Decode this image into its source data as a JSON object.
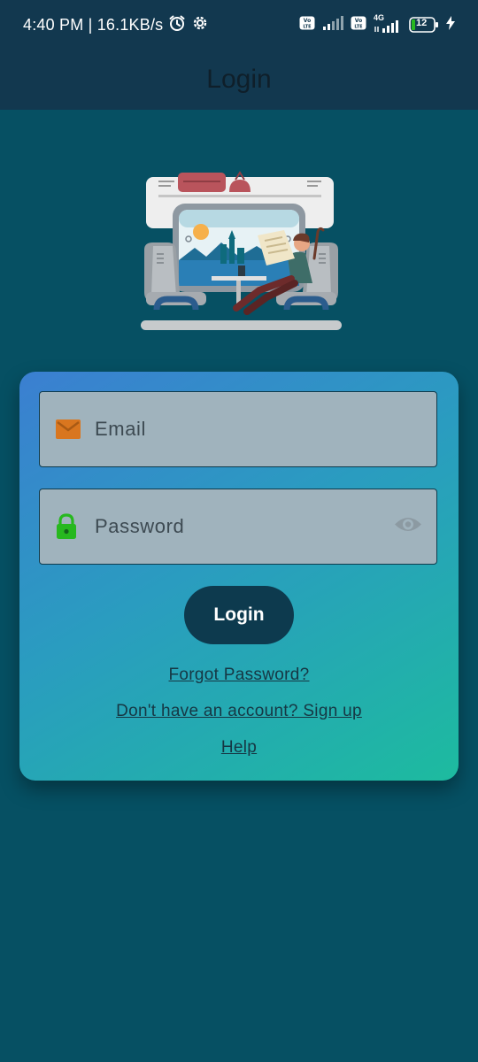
{
  "status_bar": {
    "time_speed": "4:40 PM | 16.1KB/s",
    "alarm_icon": "alarm-clock-icon",
    "settings_icon": "gear-icon",
    "volte_badge": "Vo LTE",
    "network_type": "4G",
    "battery_level": "12",
    "charging_icon": "lightning-icon"
  },
  "app_bar": {
    "title": "Login"
  },
  "hero": {
    "illustration": "train-passenger-reading-newspaper-illustration"
  },
  "login_form": {
    "email": {
      "placeholder": "Email",
      "value": "",
      "icon": "envelope-icon"
    },
    "password": {
      "placeholder": "Password",
      "value": "",
      "icon": "lock-icon",
      "toggle_icon": "eye-icon"
    },
    "login_label": "Login",
    "forgot_password": "Forgot Password?",
    "signup": "Don't have an account? Sign up",
    "help": "Help"
  },
  "colors": {
    "background": "#065063",
    "app_bar": "#12384f",
    "card_gradient_start": "#3b7fd1",
    "card_gradient_end": "#1dbb9f",
    "button": "#0d3a4e",
    "email_icon": "#d9761f",
    "lock_icon": "#27b81f"
  }
}
